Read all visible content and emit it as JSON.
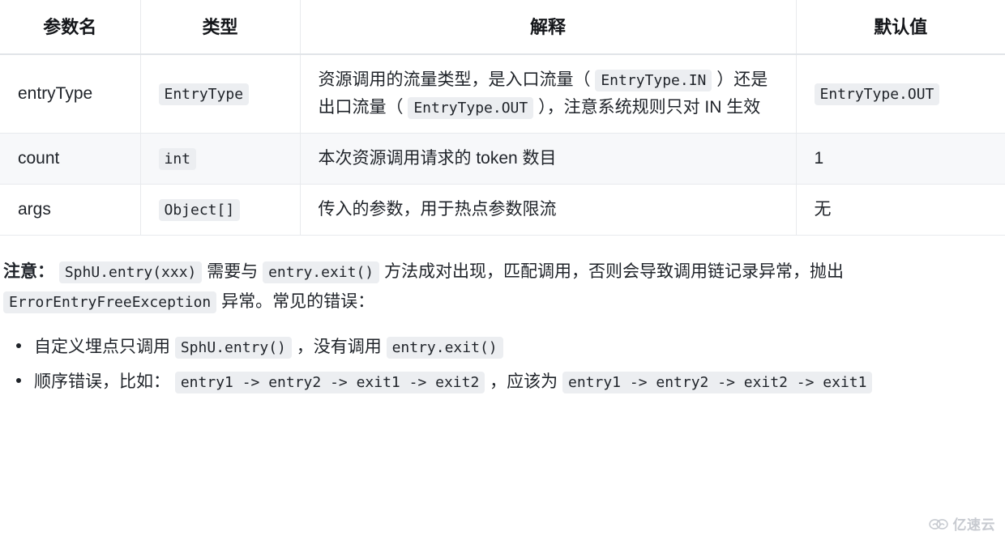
{
  "table": {
    "headers": [
      "参数名",
      "类型",
      "解释",
      "默认值"
    ],
    "rows": [
      {
        "name": "entryType",
        "type": "EntryType",
        "desc_parts": [
          {
            "t": "text",
            "v": "资源调用的流量类型，是入口流量（"
          },
          {
            "t": "code",
            "v": "EntryType.IN"
          },
          {
            "t": "text",
            "v": "）还是出口流量（"
          },
          {
            "t": "code",
            "v": "EntryType.OUT"
          },
          {
            "t": "text",
            "v": "），注意系统规则只对 IN 生效"
          }
        ],
        "default": "EntryType.OUT",
        "default_is_code": true,
        "striped": false
      },
      {
        "name": "count",
        "type": "int",
        "desc_parts": [
          {
            "t": "text",
            "v": "本次资源调用请求的 token 数目"
          }
        ],
        "default": "1",
        "default_is_code": false,
        "striped": true
      },
      {
        "name": "args",
        "type": "Object[]",
        "desc_parts": [
          {
            "t": "text",
            "v": "传入的参数，用于热点参数限流"
          }
        ],
        "default": "无",
        "default_is_code": false,
        "striped": false
      }
    ]
  },
  "note": {
    "parts": [
      {
        "t": "bold",
        "v": "注意："
      },
      {
        "t": "code",
        "v": "SphU.entry(xxx)"
      },
      {
        "t": "text",
        "v": "需要与"
      },
      {
        "t": "code",
        "v": "entry.exit()"
      },
      {
        "t": "text",
        "v": "方法成对出现，匹配调用，否则会导致调用链记录异常，抛出"
      },
      {
        "t": "code",
        "v": "ErrorEntryFreeException"
      },
      {
        "t": "text",
        "v": "异常。常见的错误："
      }
    ]
  },
  "error_list": {
    "items": [
      {
        "parts": [
          {
            "t": "text",
            "v": "自定义埋点只调用"
          },
          {
            "t": "code",
            "v": "SphU.entry()"
          },
          {
            "t": "text",
            "v": "，没有调用"
          },
          {
            "t": "code",
            "v": "entry.exit()"
          }
        ]
      },
      {
        "parts": [
          {
            "t": "text",
            "v": "顺序错误，比如："
          },
          {
            "t": "code",
            "v": "entry1 -> entry2 -> exit1 -> exit2"
          },
          {
            "t": "text",
            "v": "，应该为"
          },
          {
            "t": "code",
            "v": "entry1 -> entry2 -> exit2 -> exit1"
          }
        ]
      }
    ]
  },
  "watermark": {
    "text": "亿速云",
    "icon": "cloud-icon",
    "color": "#9aa0ab"
  }
}
